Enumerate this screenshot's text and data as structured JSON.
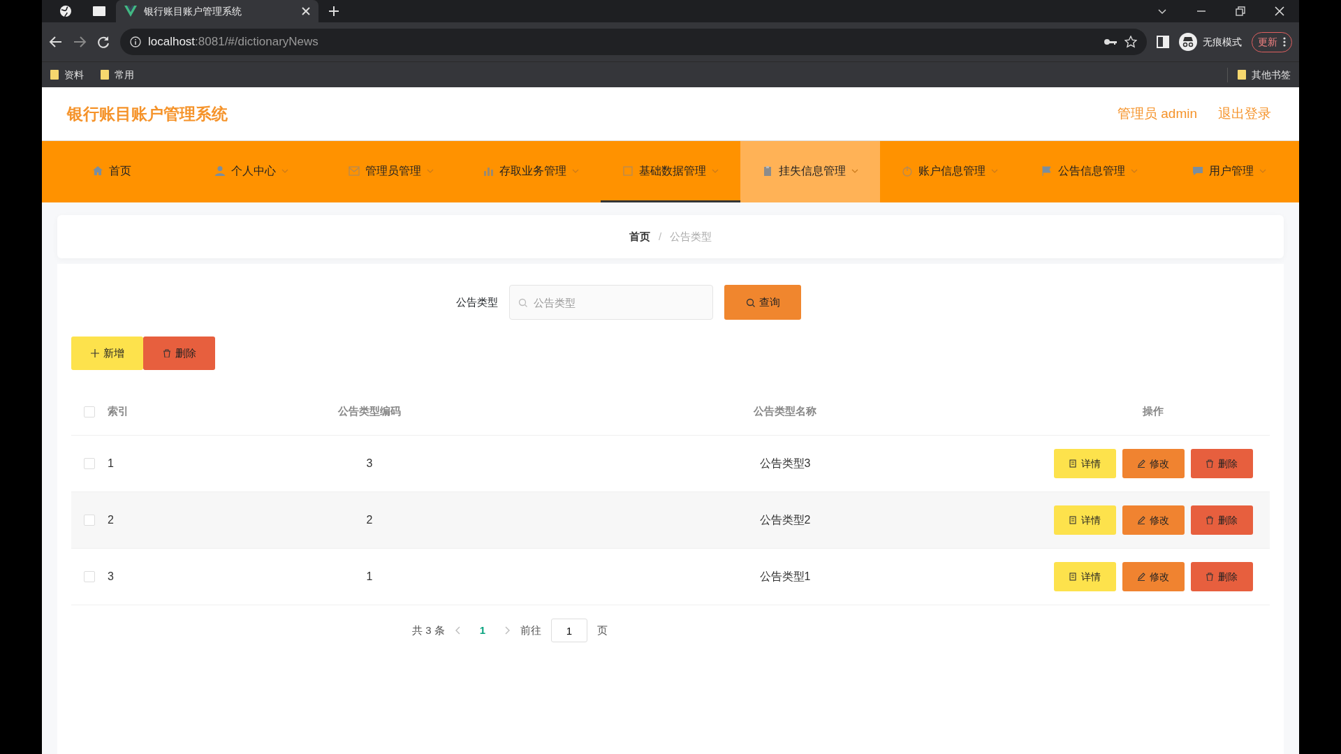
{
  "browser": {
    "tabs": [
      {
        "title": "银行账目账户管理系统",
        "selected": true
      }
    ],
    "address": {
      "host": "localhost",
      "rest": ":8081/#/dictionaryNews"
    },
    "profile": {
      "label": "无痕模式"
    },
    "update_button": "更新",
    "bookmarks": [
      "资料",
      "常用"
    ],
    "other_bookmarks": "其他书签"
  },
  "header": {
    "title": "银行账目账户管理系统",
    "user": "管理员 admin",
    "logout": "退出登录"
  },
  "nav": [
    {
      "label": "首页",
      "dropdown": false,
      "selected": false,
      "hovered": false
    },
    {
      "label": "个人中心",
      "dropdown": true,
      "selected": false,
      "hovered": false
    },
    {
      "label": "管理员管理",
      "dropdown": true,
      "selected": false,
      "hovered": false
    },
    {
      "label": "存取业务管理",
      "dropdown": true,
      "selected": false,
      "hovered": false
    },
    {
      "label": "基础数据管理",
      "dropdown": true,
      "selected": true,
      "hovered": false
    },
    {
      "label": "挂失信息管理",
      "dropdown": true,
      "selected": false,
      "hovered": true
    },
    {
      "label": "账户信息管理",
      "dropdown": true,
      "selected": false,
      "hovered": false
    },
    {
      "label": "公告信息管理",
      "dropdown": true,
      "selected": false,
      "hovered": false
    },
    {
      "label": "用户管理",
      "dropdown": true,
      "selected": false,
      "hovered": false
    }
  ],
  "breadcrumb": [
    "首页",
    "公告类型"
  ],
  "breadcrumb_separator": "/",
  "search": {
    "label": "公告类型",
    "placeholder": "公告类型",
    "button": "查询"
  },
  "actions": [
    {
      "kind": "add",
      "label": "新增"
    },
    {
      "kind": "delete",
      "label": "删除"
    }
  ],
  "table": {
    "header_checked": false,
    "columns": [
      "索引",
      "公告类型编码",
      "公告类型名称",
      "操作"
    ],
    "rows": [
      {
        "checked": false,
        "cells": [
          "1",
          "3",
          "公告类型3"
        ],
        "actions": [
          {
            "kind": "detail",
            "label": "详情"
          },
          {
            "kind": "edit",
            "label": "修改"
          },
          {
            "kind": "delete",
            "label": "删除"
          }
        ]
      },
      {
        "checked": false,
        "cells": [
          "2",
          "2",
          "公告类型2"
        ],
        "actions": [
          {
            "kind": "detail",
            "label": "详情"
          },
          {
            "kind": "edit",
            "label": "修改"
          },
          {
            "kind": "delete",
            "label": "删除"
          }
        ]
      },
      {
        "checked": false,
        "cells": [
          "3",
          "1",
          "公告类型1"
        ],
        "actions": [
          {
            "kind": "detail",
            "label": "详情"
          },
          {
            "kind": "edit",
            "label": "修改"
          },
          {
            "kind": "delete",
            "label": "删除"
          }
        ]
      }
    ]
  },
  "pagination": {
    "total": "共 3 条",
    "pages": [
      {
        "label": "1",
        "selected": true
      }
    ],
    "goto": "前往",
    "page": "1",
    "unit": "页"
  }
}
